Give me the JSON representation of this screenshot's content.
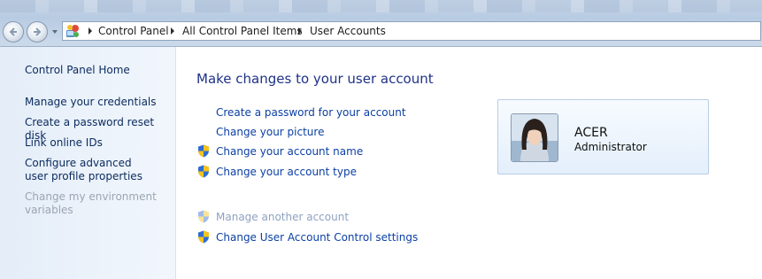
{
  "breadcrumb": {
    "items": [
      "Control Panel",
      "All Control Panel Items",
      "User Accounts"
    ]
  },
  "sidebar": {
    "home": "Control Panel Home",
    "links": [
      {
        "label": "Manage your credentials",
        "enabled": true
      },
      {
        "label": "Create a password reset disk",
        "enabled": true
      },
      {
        "label": "Link online IDs",
        "enabled": true
      },
      {
        "label": "Configure advanced user profile properties",
        "enabled": true
      },
      {
        "label": "Change my environment variables",
        "enabled": false
      }
    ]
  },
  "main": {
    "title": "Make changes to your user account",
    "tasks": [
      {
        "label": "Create a password for your account",
        "shield": false,
        "enabled": true
      },
      {
        "label": "Change your picture",
        "shield": false,
        "enabled": true
      },
      {
        "label": "Change your account name",
        "shield": true,
        "enabled": true
      },
      {
        "label": "Change your account type",
        "shield": true,
        "enabled": true
      }
    ],
    "other_tasks": [
      {
        "label": "Manage another account",
        "shield": true,
        "enabled": false
      },
      {
        "label": "Change User Account Control settings",
        "shield": true,
        "enabled": true
      }
    ]
  },
  "account": {
    "name": "ACER",
    "role": "Administrator"
  },
  "icons": [
    "back-arrow-icon",
    "forward-arrow-icon",
    "recent-pages-dropdown-icon",
    "control-panel-icon",
    "uac-shield-icon",
    "user-avatar-icon"
  ],
  "colors": {
    "link": "#0b3fa4",
    "title": "#1e3287",
    "disabled": "#9aa6b3"
  }
}
